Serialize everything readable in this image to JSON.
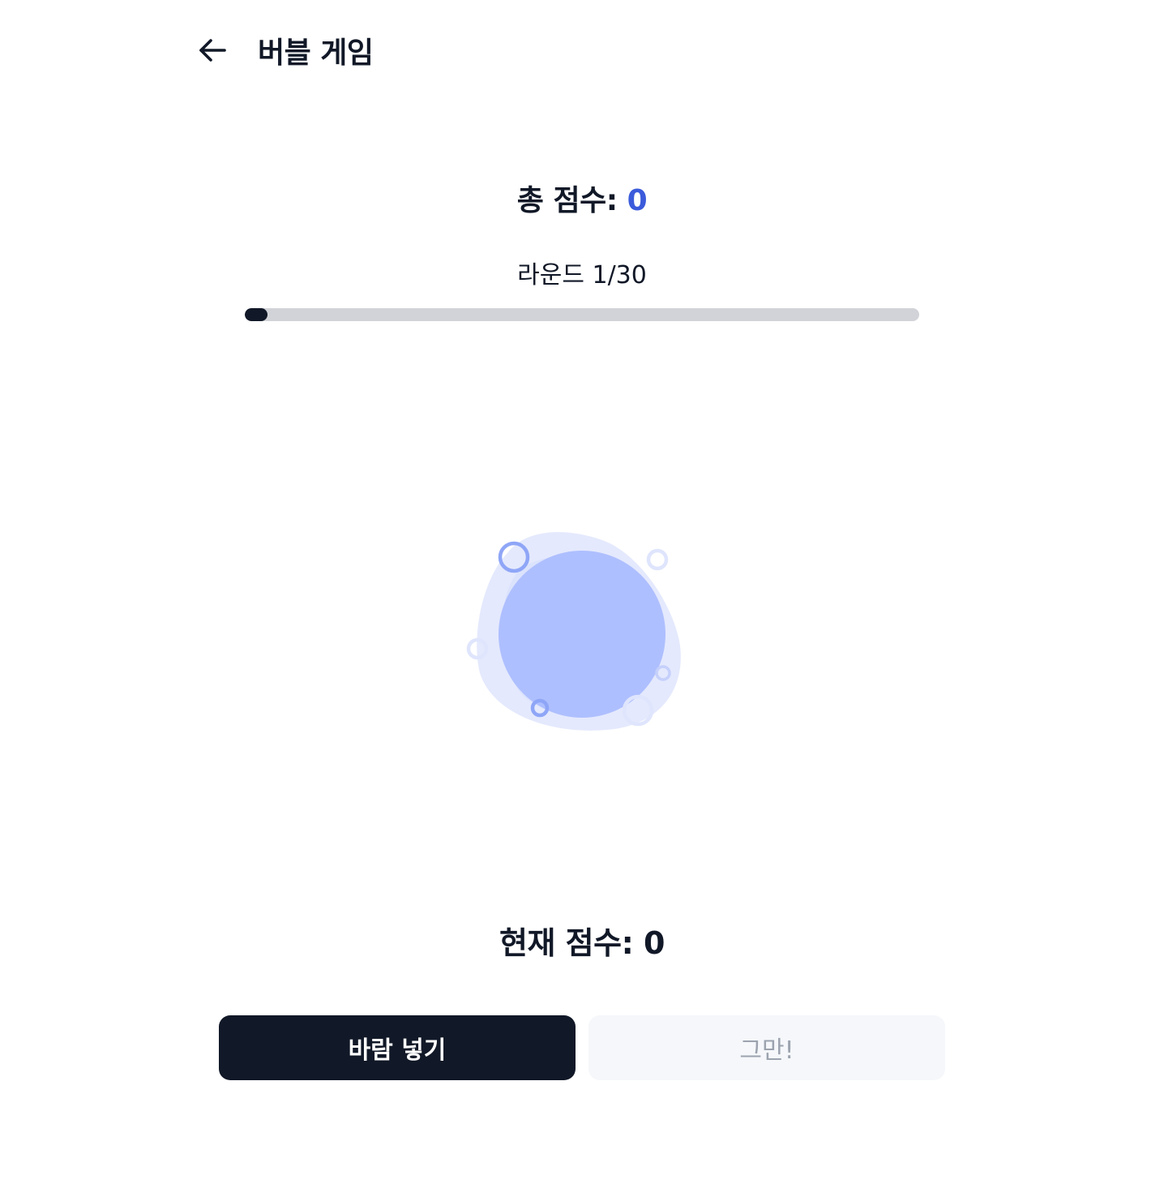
{
  "header": {
    "back_icon": "arrow-left-icon",
    "title": "버블 게임"
  },
  "score": {
    "total_label": "총 점수:",
    "total_value": "0",
    "round_text": "라운드 1/30",
    "round_current": 1,
    "round_total": 30,
    "current_label": "현재 점수:",
    "current_value": "0"
  },
  "bubble": {
    "icon": "bubble-icon",
    "fill_color": "#aebfff",
    "halo_color": "#e4e9fd",
    "ring_color": "#8fa6f7"
  },
  "buttons": {
    "blow_label": "바람 넣기",
    "stop_label": "그만!"
  },
  "colors": {
    "accent": "#3b5bdb",
    "primary": "#111827",
    "disabled_bg": "#f5f7fa",
    "disabled_text": "#9ca3af"
  }
}
